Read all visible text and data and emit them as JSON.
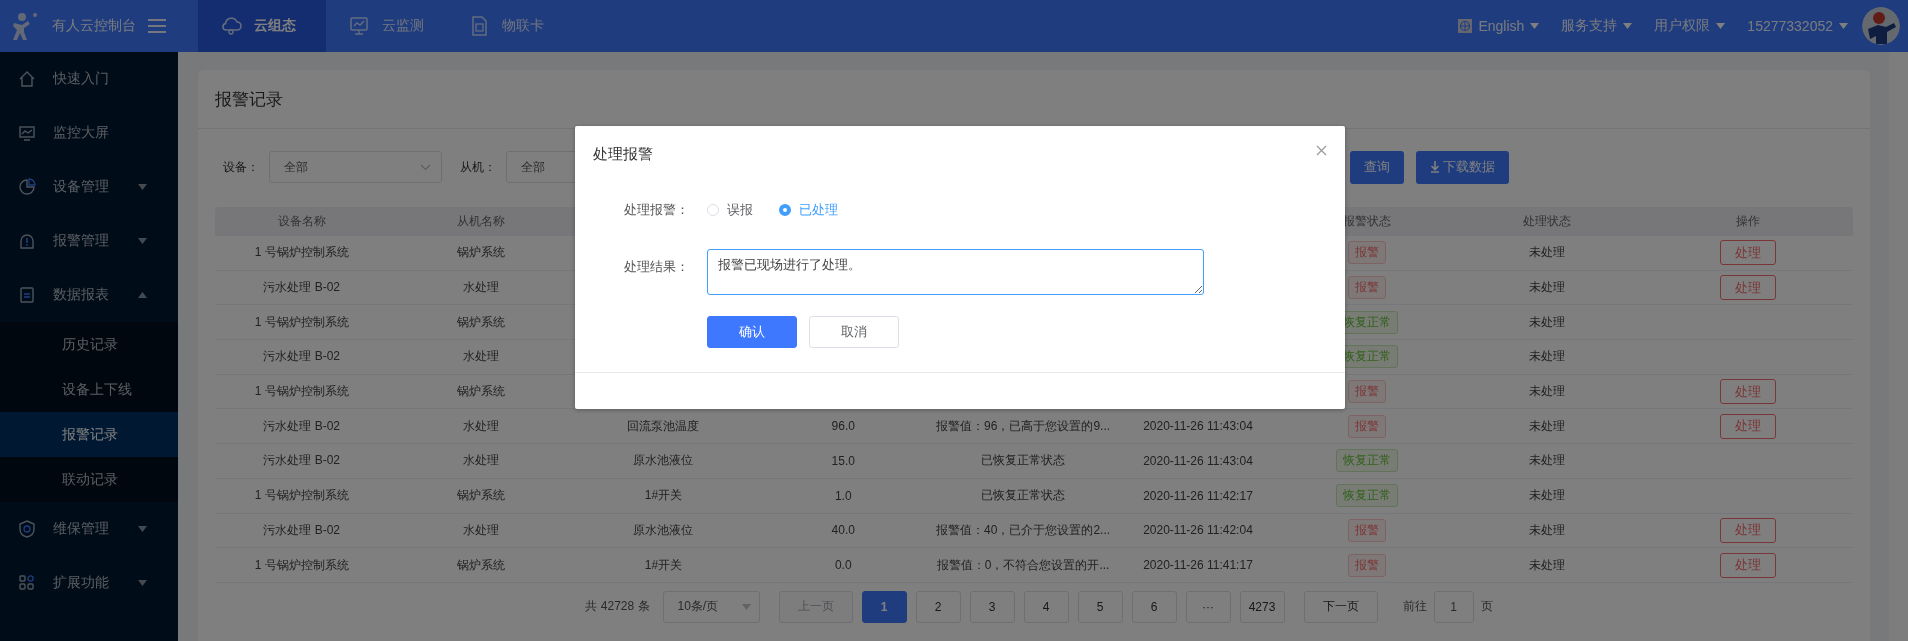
{
  "topbar": {
    "brand": "有人云控制台",
    "nav": [
      {
        "label": "云组态",
        "selected": true
      },
      {
        "label": "云监测",
        "selected": false
      },
      {
        "label": "物联卡",
        "selected": false
      }
    ],
    "menus": [
      {
        "label": "English",
        "kind": "language"
      },
      {
        "label": "服务支持",
        "kind": "plain"
      },
      {
        "label": "用户权限",
        "kind": "plain"
      },
      {
        "label": "15277332052",
        "kind": "plain"
      }
    ]
  },
  "sidebar": {
    "items": [
      {
        "label": "快速入门",
        "selected": false
      },
      {
        "label": "监控大屏",
        "selected": false
      },
      {
        "label": "设备管理",
        "selected": false,
        "expanded": false
      },
      {
        "label": "报警管理",
        "selected": false,
        "expanded": false
      },
      {
        "label": "数据报表",
        "selected": false,
        "expanded": true,
        "children": [
          {
            "label": "历史记录",
            "selected": false
          },
          {
            "label": "设备上下线",
            "selected": false
          },
          {
            "label": "报警记录",
            "selected": true
          },
          {
            "label": "联动记录",
            "selected": false
          }
        ]
      },
      {
        "label": "维保管理",
        "selected": false,
        "expanded": false
      },
      {
        "label": "扩展功能",
        "selected": false,
        "expanded": false
      }
    ]
  },
  "page": {
    "title": "报警记录",
    "filters": [
      {
        "label": "设备：",
        "value": "全部"
      },
      {
        "label": "从机：",
        "value": "全部"
      }
    ],
    "buttons": [
      {
        "label": "查询",
        "kind": "query"
      },
      {
        "label": "下载数据",
        "kind": "download"
      }
    ],
    "table": {
      "columns": [
        "设备名称",
        "从机名称",
        null,
        null,
        null,
        null,
        "报警状态",
        "处理状态",
        "操作"
      ],
      "rows": [
        {
          "device": "1 号锅炉控制系统",
          "slave": "锅炉系统",
          "alarm_status": {
            "text": "报警",
            "kind": "alarm"
          },
          "handle_status": "未处理",
          "action": "处理"
        },
        {
          "device": "污水处理 B-02",
          "slave": "水处理",
          "alarm_status": {
            "text": "报警",
            "kind": "alarm"
          },
          "handle_status": "未处理",
          "action": "处理"
        },
        {
          "device": "1 号锅炉控制系统",
          "slave": "锅炉系统",
          "alarm_status": {
            "text": "恢复正常",
            "kind": "normal"
          },
          "handle_status": "未处理"
        },
        {
          "device": "污水处理 B-02",
          "slave": "水处理",
          "alarm_status": {
            "text": "恢复正常",
            "kind": "normal"
          },
          "handle_status": "未处理"
        },
        {
          "device": "1 号锅炉控制系统",
          "slave": "锅炉系统",
          "alarm_status": {
            "text": "报警",
            "kind": "alarm"
          },
          "handle_status": "未处理",
          "action": "处理"
        },
        {
          "device": "污水处理 B-02",
          "slave": "水处理",
          "point": "回流泵池温度",
          "value": "96.0",
          "content": "报警值：96，已高于您设置的9...",
          "time": "2020-11-26 11:43:04",
          "alarm_status": {
            "text": "报警",
            "kind": "alarm"
          },
          "handle_status": "未处理",
          "action": "处理"
        },
        {
          "device": "污水处理 B-02",
          "slave": "水处理",
          "point": "原水池液位",
          "value": "15.0",
          "content": "已恢复正常状态",
          "time": "2020-11-26 11:43:04",
          "alarm_status": {
            "text": "恢复正常",
            "kind": "normal"
          },
          "handle_status": "未处理"
        },
        {
          "device": "1 号锅炉控制系统",
          "slave": "锅炉系统",
          "point": "1#开关",
          "value": "1.0",
          "content": "已恢复正常状态",
          "time": "2020-11-26 11:42:17",
          "alarm_status": {
            "text": "恢复正常",
            "kind": "normal"
          },
          "handle_status": "未处理"
        },
        {
          "device": "污水处理 B-02",
          "slave": "水处理",
          "point": "原水池液位",
          "value": "40.0",
          "content": "报警值：40，已介于您设置的2...",
          "time": "2020-11-26 11:42:04",
          "alarm_status": {
            "text": "报警",
            "kind": "alarm"
          },
          "handle_status": "未处理",
          "action": "处理"
        },
        {
          "device": "1 号锅炉控制系统",
          "slave": "锅炉系统",
          "point": "1#开关",
          "value": "0.0",
          "content": "报警值：0，不符合您设置的开...",
          "time": "2020-11-26 11:41:17",
          "alarm_status": {
            "text": "报警",
            "kind": "alarm"
          },
          "handle_status": "未处理",
          "action": "处理"
        }
      ]
    },
    "pagination": {
      "total": "共 42728 条",
      "page_size": "10条/页",
      "prev": {
        "label": "上一页",
        "disabled": true
      },
      "pages": [
        {
          "label": "1",
          "selected": true
        },
        {
          "label": "2",
          "selected": false
        },
        {
          "label": "3",
          "selected": false
        },
        {
          "label": "4",
          "selected": false
        },
        {
          "label": "5",
          "selected": false
        },
        {
          "label": "6",
          "selected": false
        },
        {
          "label": "···",
          "selected": false
        },
        {
          "label": "4273",
          "selected": false
        }
      ],
      "next": {
        "label": "下一页",
        "disabled": false
      },
      "jump": {
        "prefix": "前往",
        "value": "1",
        "suffix": "页"
      }
    }
  },
  "dialog": {
    "title": "处理报警",
    "radio_label": "处理报警：",
    "options": [
      {
        "label": "误报",
        "selected": false
      },
      {
        "label": "已处理",
        "selected": true
      }
    ],
    "result_label": "处理结果：",
    "result": "报警已现场进行了处理。",
    "buttons": [
      {
        "label": "确认",
        "kind": "primary"
      },
      {
        "label": "取消",
        "kind": "default"
      }
    ]
  }
}
